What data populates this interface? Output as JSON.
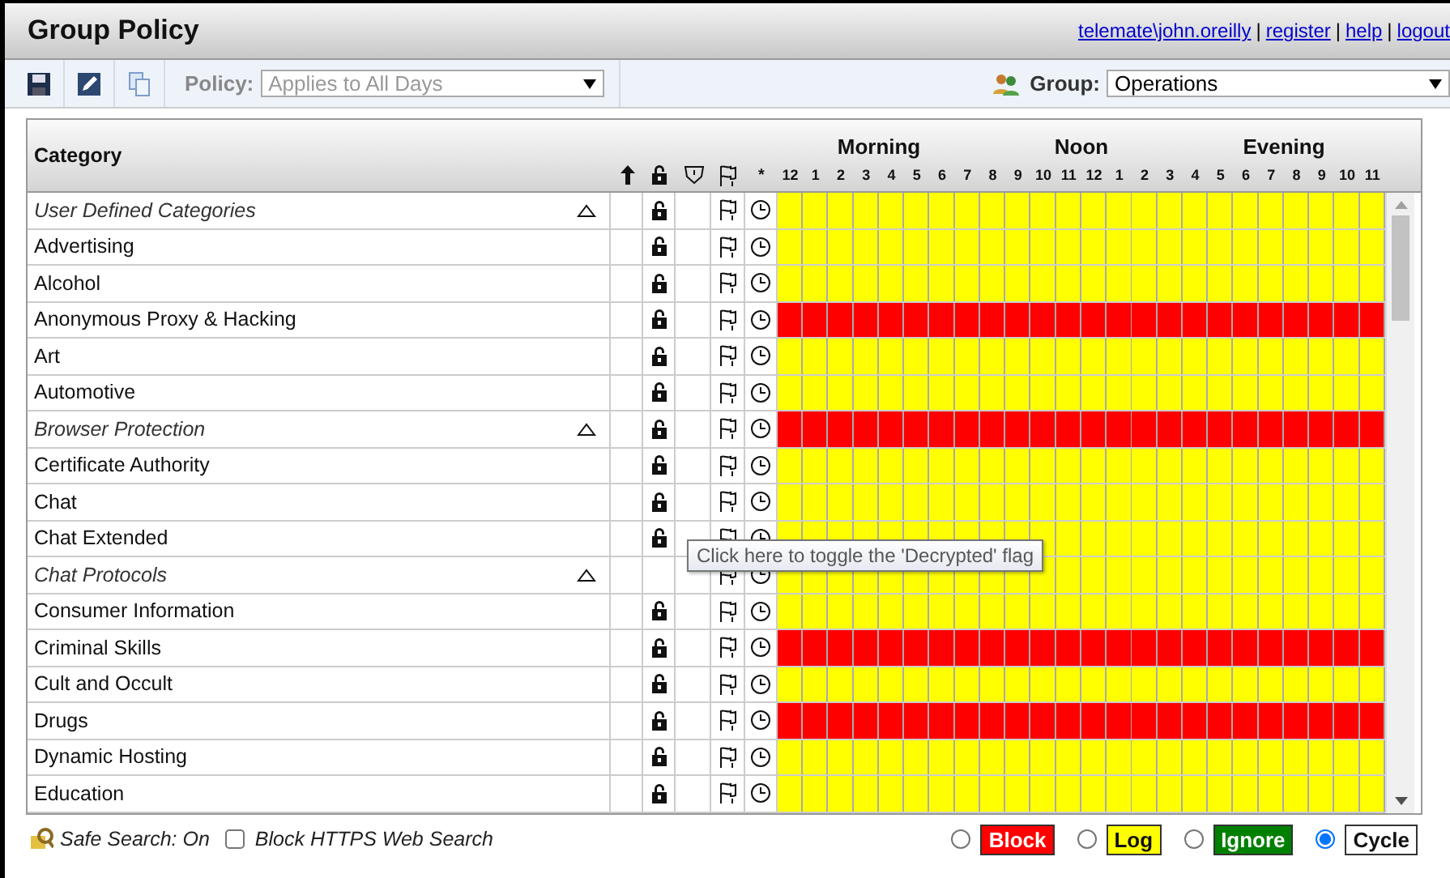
{
  "window": {
    "title": "Group Policy"
  },
  "link_separator": "|",
  "user_links": [
    {
      "label": "telemate\\john.oreilly"
    },
    {
      "label": "register"
    },
    {
      "label": "help"
    },
    {
      "label": "logout"
    }
  ],
  "toolbar": {
    "policy_label": "Policy:",
    "policy_value": "Applies to All Days",
    "group_label": "Group:",
    "group_value": "Operations"
  },
  "table": {
    "category_header": "Category",
    "flags_header": "*",
    "periods": [
      "Morning",
      "Noon",
      "Evening"
    ],
    "hours": [
      "12",
      "1",
      "2",
      "3",
      "4",
      "5",
      "6",
      "7",
      "8",
      "9",
      "10",
      "11",
      "12",
      "1",
      "2",
      "3",
      "4",
      "5",
      "6",
      "7",
      "8",
      "9",
      "10",
      "11"
    ],
    "rows": [
      {
        "label": "User Defined Categories",
        "kind": "group",
        "lock": true,
        "blocked": false
      },
      {
        "label": "Advertising",
        "kind": "category",
        "lock": true,
        "blocked": false
      },
      {
        "label": "Alcohol",
        "kind": "category",
        "lock": true,
        "blocked": false
      },
      {
        "label": "Anonymous Proxy & Hacking",
        "kind": "category",
        "lock": true,
        "blocked": true
      },
      {
        "label": "Art",
        "kind": "category",
        "lock": true,
        "blocked": false
      },
      {
        "label": "Automotive",
        "kind": "category",
        "lock": true,
        "blocked": false
      },
      {
        "label": "Browser Protection",
        "kind": "group",
        "lock": true,
        "blocked": true
      },
      {
        "label": "Certificate Authority",
        "kind": "category",
        "lock": true,
        "blocked": false
      },
      {
        "label": "Chat",
        "kind": "category",
        "lock": true,
        "blocked": false
      },
      {
        "label": "Chat Extended",
        "kind": "category",
        "lock": true,
        "blocked": false
      },
      {
        "label": "Chat Protocols",
        "kind": "group",
        "lock": false,
        "blocked": false
      },
      {
        "label": "Consumer Information",
        "kind": "category",
        "lock": true,
        "blocked": false
      },
      {
        "label": "Criminal Skills",
        "kind": "category",
        "lock": true,
        "blocked": true
      },
      {
        "label": "Cult and Occult",
        "kind": "category",
        "lock": true,
        "blocked": false
      },
      {
        "label": "Drugs",
        "kind": "category",
        "lock": true,
        "blocked": true
      },
      {
        "label": "Dynamic Hosting",
        "kind": "category",
        "lock": true,
        "blocked": false
      },
      {
        "label": "Education",
        "kind": "category",
        "lock": true,
        "blocked": false
      }
    ]
  },
  "tooltip": "Click here to toggle the 'Decrypted' flag",
  "footer": {
    "safe_search": "Safe Search: On",
    "https_option": {
      "label": "Block HTTPS Web Search",
      "checked": false
    },
    "legend": [
      {
        "label": "Block",
        "color": "#ff0000",
        "selected": false
      },
      {
        "label": "Log",
        "color": "#ffff00",
        "selected": false
      },
      {
        "label": "Ignore",
        "color": "#008000",
        "selected": false
      },
      {
        "label": "Cycle",
        "color": "#ffffff",
        "selected": true
      }
    ]
  }
}
